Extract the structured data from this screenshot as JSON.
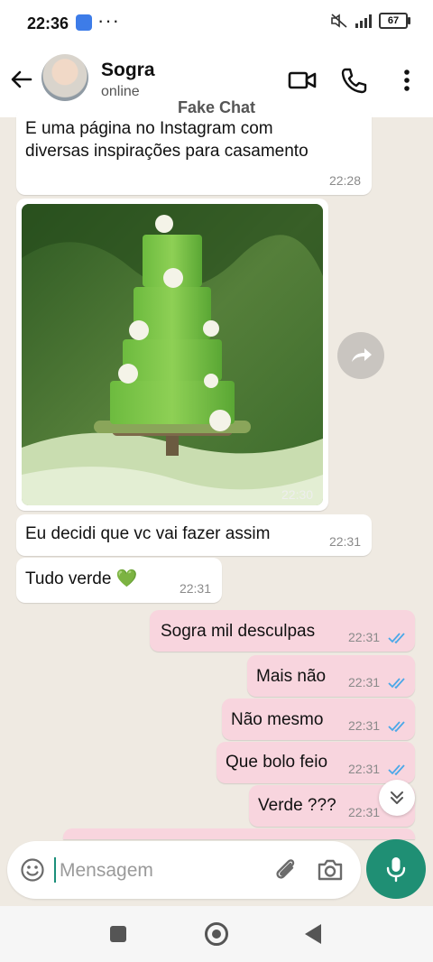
{
  "status_bar": {
    "time": "22:36",
    "more": "···",
    "battery": "67"
  },
  "header": {
    "contact_name": "Sogra",
    "contact_status": "online"
  },
  "watermark": "Fake Chat",
  "messages": [
    {
      "dir": "in",
      "text": "E uma página no Instagram com\ndiversas inspirações para casamento",
      "time": "22:28"
    },
    {
      "dir": "in",
      "type": "image",
      "time": "22:30"
    },
    {
      "dir": "in",
      "text": "Eu decidi que vc vai fazer assim",
      "time": "22:31"
    },
    {
      "dir": "in",
      "text": "Tudo verde 💚",
      "time": "22:31"
    },
    {
      "dir": "out",
      "text": "Sogra mil desculpas",
      "time": "22:31",
      "status": "read"
    },
    {
      "dir": "out",
      "text": "Mais não",
      "time": "22:31",
      "status": "read"
    },
    {
      "dir": "out",
      "text": "Não mesmo",
      "time": "22:31",
      "status": "read"
    },
    {
      "dir": "out",
      "text": "Que bolo feio",
      "time": "22:31",
      "status": "read"
    },
    {
      "dir": "out",
      "text": "Verde ???",
      "time": "22:31",
      "status": "read"
    }
  ],
  "composer": {
    "placeholder": "Mensagem"
  },
  "icons": {
    "back": "arrow-left-icon",
    "video": "video-camera-icon",
    "call": "phone-icon",
    "menu": "more-vertical-icon",
    "emoji": "emoji-icon",
    "attach": "paperclip-icon",
    "camera": "camera-icon",
    "mic": "microphone-icon",
    "forward": "forward-icon",
    "scroll": "chevrons-down-icon"
  },
  "colors": {
    "accent": "#1f8f74",
    "outgoing_bubble": "#f8d5de",
    "incoming_bubble": "#ffffff",
    "read_ticks": "#4aa8e8",
    "chat_bg": "#efeae2"
  }
}
